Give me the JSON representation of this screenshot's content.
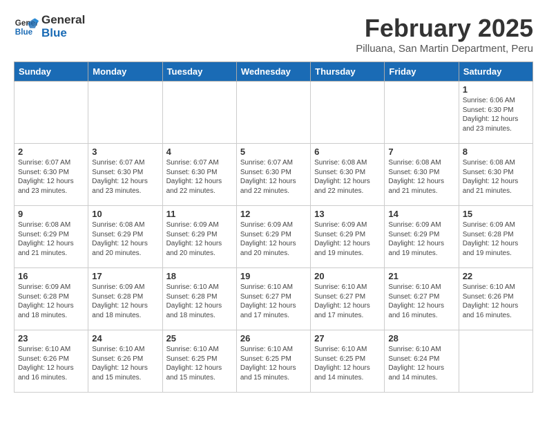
{
  "logo": {
    "line1": "General",
    "line2": "Blue"
  },
  "title": "February 2025",
  "subtitle": "Pilluana, San Martin Department, Peru",
  "weekdays": [
    "Sunday",
    "Monday",
    "Tuesday",
    "Wednesday",
    "Thursday",
    "Friday",
    "Saturday"
  ],
  "weeks": [
    [
      {
        "day": "",
        "info": ""
      },
      {
        "day": "",
        "info": ""
      },
      {
        "day": "",
        "info": ""
      },
      {
        "day": "",
        "info": ""
      },
      {
        "day": "",
        "info": ""
      },
      {
        "day": "",
        "info": ""
      },
      {
        "day": "1",
        "info": "Sunrise: 6:06 AM\nSunset: 6:30 PM\nDaylight: 12 hours\nand 23 minutes."
      }
    ],
    [
      {
        "day": "2",
        "info": "Sunrise: 6:07 AM\nSunset: 6:30 PM\nDaylight: 12 hours\nand 23 minutes."
      },
      {
        "day": "3",
        "info": "Sunrise: 6:07 AM\nSunset: 6:30 PM\nDaylight: 12 hours\nand 23 minutes."
      },
      {
        "day": "4",
        "info": "Sunrise: 6:07 AM\nSunset: 6:30 PM\nDaylight: 12 hours\nand 22 minutes."
      },
      {
        "day": "5",
        "info": "Sunrise: 6:07 AM\nSunset: 6:30 PM\nDaylight: 12 hours\nand 22 minutes."
      },
      {
        "day": "6",
        "info": "Sunrise: 6:08 AM\nSunset: 6:30 PM\nDaylight: 12 hours\nand 22 minutes."
      },
      {
        "day": "7",
        "info": "Sunrise: 6:08 AM\nSunset: 6:30 PM\nDaylight: 12 hours\nand 21 minutes."
      },
      {
        "day": "8",
        "info": "Sunrise: 6:08 AM\nSunset: 6:30 PM\nDaylight: 12 hours\nand 21 minutes."
      }
    ],
    [
      {
        "day": "9",
        "info": "Sunrise: 6:08 AM\nSunset: 6:29 PM\nDaylight: 12 hours\nand 21 minutes."
      },
      {
        "day": "10",
        "info": "Sunrise: 6:08 AM\nSunset: 6:29 PM\nDaylight: 12 hours\nand 20 minutes."
      },
      {
        "day": "11",
        "info": "Sunrise: 6:09 AM\nSunset: 6:29 PM\nDaylight: 12 hours\nand 20 minutes."
      },
      {
        "day": "12",
        "info": "Sunrise: 6:09 AM\nSunset: 6:29 PM\nDaylight: 12 hours\nand 20 minutes."
      },
      {
        "day": "13",
        "info": "Sunrise: 6:09 AM\nSunset: 6:29 PM\nDaylight: 12 hours\nand 19 minutes."
      },
      {
        "day": "14",
        "info": "Sunrise: 6:09 AM\nSunset: 6:29 PM\nDaylight: 12 hours\nand 19 minutes."
      },
      {
        "day": "15",
        "info": "Sunrise: 6:09 AM\nSunset: 6:28 PM\nDaylight: 12 hours\nand 19 minutes."
      }
    ],
    [
      {
        "day": "16",
        "info": "Sunrise: 6:09 AM\nSunset: 6:28 PM\nDaylight: 12 hours\nand 18 minutes."
      },
      {
        "day": "17",
        "info": "Sunrise: 6:09 AM\nSunset: 6:28 PM\nDaylight: 12 hours\nand 18 minutes."
      },
      {
        "day": "18",
        "info": "Sunrise: 6:10 AM\nSunset: 6:28 PM\nDaylight: 12 hours\nand 18 minutes."
      },
      {
        "day": "19",
        "info": "Sunrise: 6:10 AM\nSunset: 6:27 PM\nDaylight: 12 hours\nand 17 minutes."
      },
      {
        "day": "20",
        "info": "Sunrise: 6:10 AM\nSunset: 6:27 PM\nDaylight: 12 hours\nand 17 minutes."
      },
      {
        "day": "21",
        "info": "Sunrise: 6:10 AM\nSunset: 6:27 PM\nDaylight: 12 hours\nand 16 minutes."
      },
      {
        "day": "22",
        "info": "Sunrise: 6:10 AM\nSunset: 6:26 PM\nDaylight: 12 hours\nand 16 minutes."
      }
    ],
    [
      {
        "day": "23",
        "info": "Sunrise: 6:10 AM\nSunset: 6:26 PM\nDaylight: 12 hours\nand 16 minutes."
      },
      {
        "day": "24",
        "info": "Sunrise: 6:10 AM\nSunset: 6:26 PM\nDaylight: 12 hours\nand 15 minutes."
      },
      {
        "day": "25",
        "info": "Sunrise: 6:10 AM\nSunset: 6:25 PM\nDaylight: 12 hours\nand 15 minutes."
      },
      {
        "day": "26",
        "info": "Sunrise: 6:10 AM\nSunset: 6:25 PM\nDaylight: 12 hours\nand 15 minutes."
      },
      {
        "day": "27",
        "info": "Sunrise: 6:10 AM\nSunset: 6:25 PM\nDaylight: 12 hours\nand 14 minutes."
      },
      {
        "day": "28",
        "info": "Sunrise: 6:10 AM\nSunset: 6:24 PM\nDaylight: 12 hours\nand 14 minutes."
      },
      {
        "day": "",
        "info": ""
      }
    ]
  ]
}
